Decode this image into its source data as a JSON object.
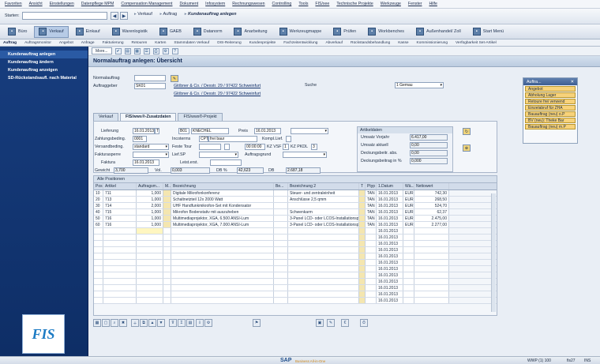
{
  "menu": [
    "Favoriten",
    "Ansicht",
    "Einstellungen",
    "Datenpflege MPM",
    "Compensation Management",
    "Dokument",
    "Infosystem",
    "Rechnungswesen",
    "Controlling",
    "Tools",
    "FIS/xee",
    "Technische Projekte",
    "Werkzeuge",
    "Fenster",
    "Hilfe"
  ],
  "command": {
    "label": "Starten:",
    "value": ""
  },
  "breadcrumb": [
    "Verkauf",
    "Auftrag",
    "Kundenauftrag anlegen"
  ],
  "toolbar2": [
    {
      "label": "Büro",
      "selected": false
    },
    {
      "label": "Verkauf",
      "selected": true
    },
    {
      "label": "Einkauf",
      "selected": false
    },
    {
      "label": "Warenlogistik",
      "selected": false
    },
    {
      "label": "GAEB",
      "selected": false
    },
    {
      "label": "Datanorm",
      "selected": false
    },
    {
      "label": "Anarbeitung",
      "selected": false
    },
    {
      "label": "Werkzeugmappe",
      "selected": false
    },
    {
      "label": "Prüfen",
      "selected": false
    },
    {
      "label": "Workbenches",
      "selected": false
    },
    {
      "label": "Außenhandel/ Zoll",
      "selected": false
    },
    {
      "label": "Start Menü",
      "selected": false
    }
  ],
  "tabs": [
    "Auftrag",
    "Auftragsmonitor",
    "Angebot",
    "Anfrage",
    "Fakturierung",
    "Retouren",
    "Karten",
    "Stammdaten Verkauf",
    "DIS-Reiterung",
    "Kundenprojekte",
    "Fachzeitentwicklung",
    "Abverkauf",
    "Rückstandsbehandlung",
    "Kasse",
    "Kommissionierung",
    "Verfügbarkeit Set-Artikel"
  ],
  "sidebar": [
    "Kundenauftrag anlegen",
    "Kundenauftrag ändern",
    "Kundenauftrag anzeigen",
    "SD-Rückstandsaufl. nach Material"
  ],
  "logo": "FIS",
  "toolbar3": {
    "more": "More..."
  },
  "title": "Normalauftrag anlegen: Übersicht",
  "header": {
    "auftrag_label": "Normalauftrag",
    "auftrag_value": "",
    "auftraggeber_label": "Auftraggeber",
    "auftraggeber_value": "SK01",
    "auftraggeber_addr": "Glöbner & Co. / Dexstr. 29 / 97422 Schweinfurt",
    "warenempf_addr": "Glöbner & Co. / Dexstr. 29 / 97422 Schweinfurt",
    "search_label": "Suche",
    "search_value": "1 Gemau"
  },
  "detail_tabs": [
    "Verkauf",
    "FIS/wws®-Zusatzdaten",
    "FIS/wws®-Projekt"
  ],
  "form": {
    "lieferung_label": "Lieferung",
    "lieferung_value": "16.01.2013",
    "lieferung_t": "T",
    "anlieferer_code": "B01",
    "anlieferer_name": "KNECHEL",
    "preis_label": "Preis",
    "preis_value": "16.01.2013",
    "zahlung_label": "Zahlungsbeding.",
    "zahlung_value": "0001",
    "incoterms_label": "Incoterms",
    "incoterms_code": "CPT",
    "incoterms_text": "frei baur",
    "komplett_label": "Kompl.Lief.",
    "versand_label": "Versandbeding.",
    "versand_value": "standard",
    "feste_tour_label": "Feste Tour",
    "zeit_value": "00:00:00",
    "kz_vsf_label": "KZ VSF",
    "kz_vsf_value": "1",
    "kz_pkdl_label": "KZ PKDL",
    "kz_pkdl_value": "3",
    "fakturasperre_label": "Fakturasperre",
    "lief_sp_label": "Lief.SP",
    "auftragsgrund_label": "Auftragsgrund",
    "faktura_label": "Faktura",
    "faktura_value": "16.01.2013",
    "leist_label": "Leist.erst.",
    "gewicht_label": "Gewicht",
    "gewicht_value": "3,700",
    "vol_label": "Vol.",
    "vol_value": "0,003",
    "db_pct_label": "DB %",
    "db_pct_value": "42,623",
    "db_label": "DB",
    "db_value": "2.687,18"
  },
  "artikeldaten": {
    "title": "Artikeldaten",
    "rows": [
      {
        "label": "Umsatz Vorjahr",
        "value": "6.417,00"
      },
      {
        "label": "Umsatz aktuell",
        "value": "0,00"
      },
      {
        "label": "Deckungsbeitr. abs.",
        "value": "0,00"
      },
      {
        "label": "Deckungsbeitrag in %",
        "value": "0,000"
      }
    ]
  },
  "items": {
    "title": "Alle Positionen",
    "columns": [
      "Pos",
      "Artikel",
      "Auftragsm...",
      "M...",
      "Bezeichnung",
      "Be...",
      "Bezeichnung 2",
      "T",
      "Ptyp",
      "1.Datum",
      "Wä...",
      "Nettowert"
    ],
    "rows": [
      {
        "pos": "10",
        "artikel": "711",
        "menge": "1,000",
        "bez": "Digitale Mikrofonkonferenz",
        "bez2": "Steuer- und zentraleinheit",
        "ptyp": "TAN",
        "datum": "16.01.2013",
        "waehr": "EUR",
        "netto": "742,30"
      },
      {
        "pos": "20",
        "artikel": "713",
        "menge": "1,000",
        "bez": "Schaltnetzteil 12x 2000 Watt",
        "bez2": "Anschlüsse 2,5 qmm",
        "ptyp": "TAN",
        "datum": "16.01.2013",
        "waehr": "EUR",
        "netto": "268,50"
      },
      {
        "pos": "30",
        "artikel": "714",
        "menge": "2,000",
        "bez": "UHF Handfunkmikrofon-Set mit Kondensator",
        "bez2": "",
        "ptyp": "TAN",
        "datum": "16.01.2013",
        "waehr": "EUR",
        "netto": "524,70"
      },
      {
        "pos": "40",
        "artikel": "715",
        "menge": "1,000",
        "bez": "Mikrofon Bodenstativ mit auszuheben",
        "bez2": "Schwenkarm",
        "ptyp": "TAN",
        "datum": "16.01.2013",
        "waehr": "EUR",
        "netto": "62,37"
      },
      {
        "pos": "50",
        "artikel": "716",
        "menge": "1,000",
        "bez": "Multimediaprojektor, XGA, 6.500 ANSI-Lum",
        "bez2": "3-Panel LCD- oder LCOS-Installationsproj",
        "ptyp": "TAN",
        "datum": "16.01.2013",
        "waehr": "EUR",
        "netto": "2.475,00"
      },
      {
        "pos": "60",
        "artikel": "716",
        "menge": "1,000",
        "bez": "Multimediaprojektor, XGA, 7.000 ANSI-Lum",
        "bez2": "3-Panel LCD- oder LCOS-Installationsproj",
        "ptyp": "TAN",
        "datum": "16.01.2013",
        "waehr": "EUR",
        "netto": "2.277,00"
      }
    ],
    "empty_dates": [
      "16.01.2013",
      "16.01.2013",
      "16.01.2013",
      "16.01.2013",
      "16.01.2013",
      "16.01.2013",
      "16.01.2013",
      "16.01.2013",
      "16.01.2013",
      "16.01.2013",
      "16.01.2013",
      "16.01.2013"
    ]
  },
  "worklist": {
    "title": "Auftra...",
    "items": [
      "Angebot",
      "Abholung Lager",
      "Retoure frei verwend",
      "Einzelabruf für ZHA",
      "Bauauftrag (neu) o.P",
      "BV (neu): Theke Bar",
      "Bauauftrag (neu) m.P"
    ]
  },
  "status": {
    "brand": "SAP",
    "brand_sub": "Business All-in-One",
    "system": "WWP (1) 100",
    "server": "fis27",
    "mode": "INS"
  }
}
